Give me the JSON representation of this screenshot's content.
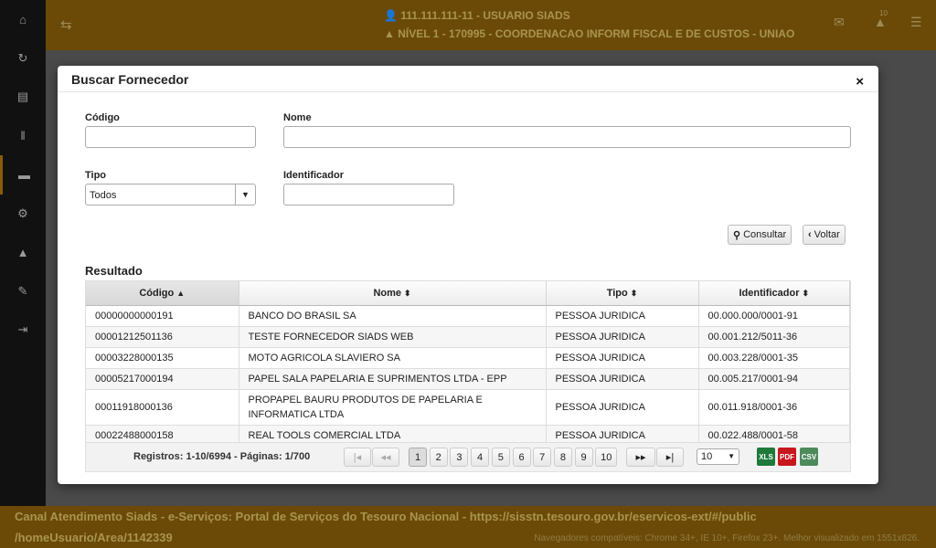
{
  "app": {
    "user_line": "111.111.111-11 - USUARIO SIADS",
    "level_line": "NÍVEL 1 - 170995 - COORDENACAO INFORM FISCAL E DE CUSTOS - UNIAO",
    "notification_count": "10",
    "footer_line1": "Canal Atendimento Siads - e-Serviços: Portal de Serviços do Tesouro Nacional - https://sisstn.tesouro.gov.br/eservicos-ext/#/public",
    "footer_line2": "/homeUsuario/Area/1142339",
    "footer_browsers": "Navegadores compatíveis: Chrome 34+, IE 10+, Firefox 23+. Melhor visualizado em 1551x826.",
    "sidebar_icons": [
      "home-icon",
      "refresh-icon",
      "document-icon",
      "barcode-icon",
      "archive-icon",
      "settings-icon",
      "warning-icon",
      "graduation-icon",
      "logout-icon"
    ]
  },
  "modal": {
    "title": "Buscar Fornecedor",
    "close": "×",
    "codigo_label": "Código",
    "codigo_value": "",
    "nome_label": "Nome",
    "nome_value": "",
    "tipo_label": "Tipo",
    "tipo_value": "Todos",
    "identificador_label": "Identificador",
    "identificador_value": "",
    "consultar_label": "Consultar",
    "voltar_label": "Voltar",
    "result_title": "Resultado"
  },
  "table": {
    "headers": [
      "Código",
      "Nome",
      "Tipo",
      "Identificador"
    ],
    "rows": [
      [
        "00000000000191",
        "BANCO DO BRASIL SA",
        "PESSOA JURIDICA",
        "00.000.000/0001-91"
      ],
      [
        "00001212501136",
        "TESTE FORNECEDOR SIADS WEB",
        "PESSOA JURIDICA",
        "00.001.212/5011-36"
      ],
      [
        "00003228000135",
        "MOTO AGRICOLA SLAVIERO SA",
        "PESSOA JURIDICA",
        "00.003.228/0001-35"
      ],
      [
        "00005217000194",
        "PAPEL SALA PAPELARIA E SUPRIMENTOS LTDA - EPP",
        "PESSOA JURIDICA",
        "00.005.217/0001-94"
      ],
      [
        "00011918000136",
        "PROPAPEL BAURU PRODUTOS DE PAPELARIA E INFORMATICA LTDA",
        "PESSOA JURIDICA",
        "00.011.918/0001-36"
      ],
      [
        "00022488000158",
        "REAL TOOLS COMERCIAL LTDA",
        "PESSOA JURIDICA",
        "00.022.488/0001-58"
      ]
    ]
  },
  "pager": {
    "records": "Registros: 1-10/6994 - Páginas: 1/700",
    "first": "|◂",
    "prev": "◂◂",
    "pages": [
      "1",
      "2",
      "3",
      "4",
      "5",
      "6",
      "7",
      "8",
      "9",
      "10"
    ],
    "current_page": "1",
    "next": "▸▸",
    "last": "▸|",
    "page_size": "10",
    "export_xls": "XLS",
    "export_pdf": "PDF",
    "export_csv": "CSV"
  },
  "colors": {
    "topbar": "#6b4a08",
    "sidebar": "#111111",
    "excel": "#1e7a3a",
    "pdf": "#c8161d",
    "csv": "#4d8a5c"
  }
}
